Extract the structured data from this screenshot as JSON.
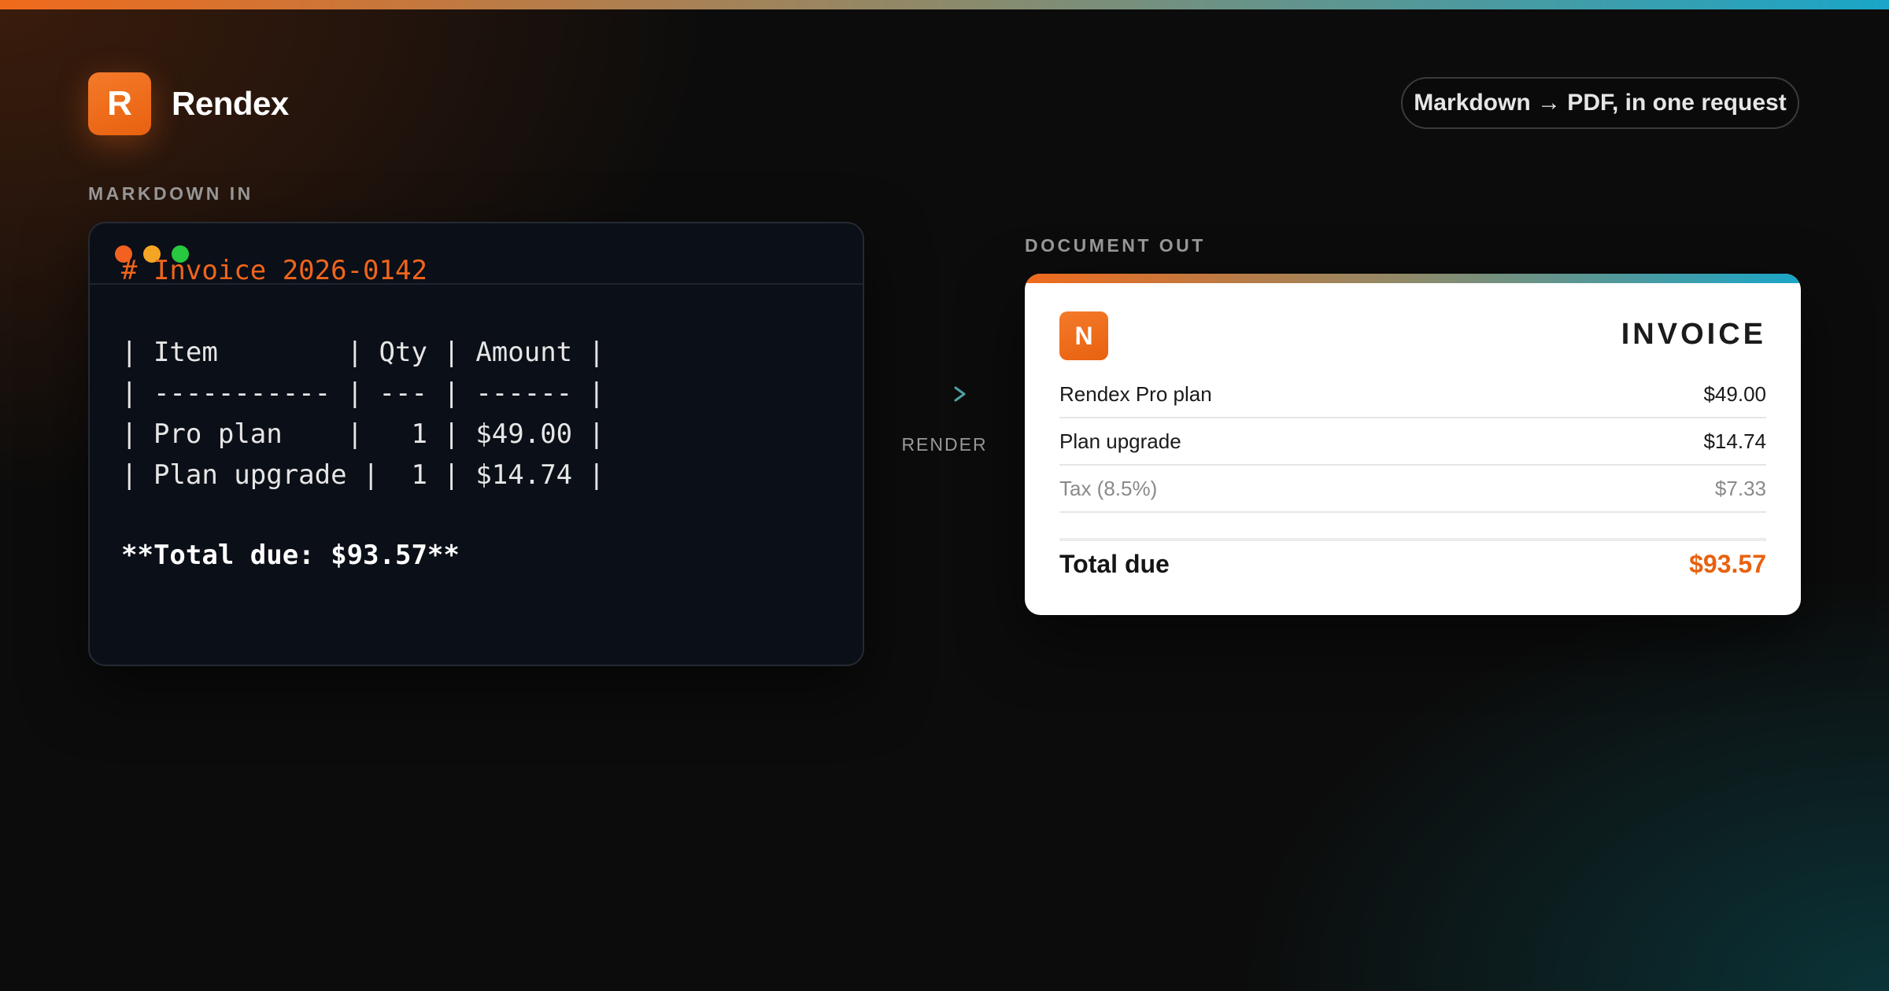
{
  "brand": {
    "logo_letter": "R",
    "name": "Rendex",
    "accent": "#f06a1c"
  },
  "tagline": "Markdown → PDF, in one request",
  "input": {
    "section_label": "MARKDOWN IN",
    "lines": [
      "# Invoice 2026-0142",
      "",
      "| Item        | Qty | Amount |",
      "| ----------- | --- | ------ |",
      "| Pro plan    |   1 | $49.00 |",
      "| Plan upgrade |  1 | $14.74 |",
      "",
      "**Total due: $93.57**"
    ]
  },
  "render_label": "RENDER",
  "output": {
    "section_label": "DOCUMENT OUT",
    "logo_letter": "N",
    "title": "INVOICE",
    "rows": [
      {
        "label": "Rendex Pro plan",
        "amount": "$49.00"
      },
      {
        "label": "Plan upgrade",
        "amount": "$14.74"
      },
      {
        "label": "Tax (8.5%)",
        "amount": "$7.33"
      }
    ],
    "total_label": "Total due",
    "total_amount": "$93.57",
    "total_color": "#e8610f"
  }
}
